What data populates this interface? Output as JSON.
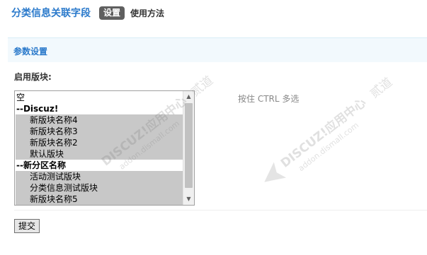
{
  "header": {
    "title": "分类信息关联字段",
    "tabs": [
      {
        "label": "设置",
        "active": true
      },
      {
        "label": "使用方法",
        "active": false
      }
    ]
  },
  "section": {
    "title": "参数设置"
  },
  "form": {
    "field_label": "启用版块:",
    "hint": "按住 CTRL 多选",
    "options": [
      {
        "label": "空",
        "type": "plain",
        "selected": false
      },
      {
        "label": "--Discuz!",
        "type": "group",
        "selected": false
      },
      {
        "label": "新版块名称4",
        "type": "child",
        "selected": true
      },
      {
        "label": "新版块名称3",
        "type": "child",
        "selected": true
      },
      {
        "label": "新版块名称2",
        "type": "child",
        "selected": true
      },
      {
        "label": "默认版块",
        "type": "child",
        "selected": true
      },
      {
        "label": "--新分区名称",
        "type": "group",
        "selected": false
      },
      {
        "label": "活动测试版块",
        "type": "child",
        "selected": true
      },
      {
        "label": "分类信息测试版块",
        "type": "child",
        "selected": true
      },
      {
        "label": "新版块名称5",
        "type": "child",
        "selected": true
      }
    ],
    "submit_label": "提交"
  },
  "watermark": {
    "brand": "DISCUZ!应用中心",
    "url": "addon.dismall.com",
    "right_text": "贰道"
  },
  "colors": {
    "accent": "#2b7acb",
    "section_bg": "#f2f9fd",
    "selected_bg": "#c8c8c8"
  }
}
